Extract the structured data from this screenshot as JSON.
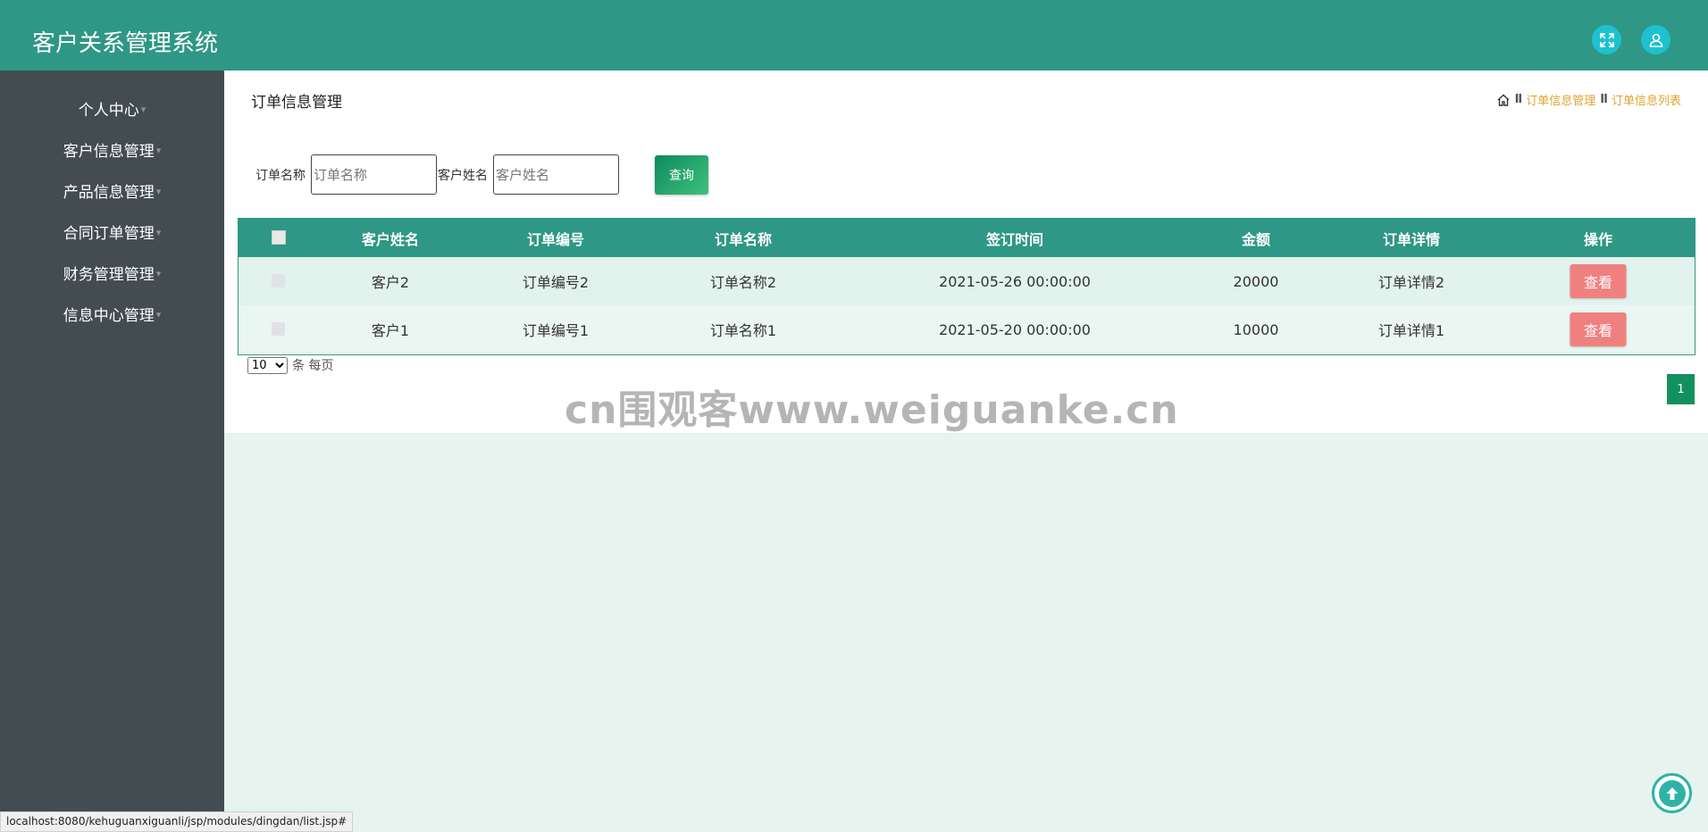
{
  "header": {
    "title": "客户关系管理系统",
    "fullscreen_icon": "expand-icon",
    "user_icon": "user-icon"
  },
  "sidebar": {
    "items": [
      {
        "label": "个人中心"
      },
      {
        "label": "客户信息管理"
      },
      {
        "label": "产品信息管理"
      },
      {
        "label": "合同订单管理"
      },
      {
        "label": "财务管理管理"
      },
      {
        "label": "信息中心管理"
      }
    ],
    "caret": "▾"
  },
  "main": {
    "title": "订单信息管理",
    "breadcrumb": {
      "sep": "II",
      "items": [
        "订单信息管理",
        "订单信息列表"
      ]
    }
  },
  "search": {
    "order_name_label": "订单名称",
    "order_name_placeholder": "订单名称",
    "customer_name_label": "客户姓名",
    "customer_name_placeholder": "客户姓名",
    "query_label": "查询"
  },
  "table": {
    "headers": [
      "客户姓名",
      "订单编号",
      "订单名称",
      "签订时间",
      "金额",
      "订单详情",
      "操作"
    ],
    "rows": [
      {
        "customer": "客户2",
        "order_no": "订单编号2",
        "order_name": "订单名称2",
        "signed_at": "2021-05-26 00:00:00",
        "amount": "20000",
        "details": "订单详情2",
        "action": "查看"
      },
      {
        "customer": "客户1",
        "order_no": "订单编号1",
        "order_name": "订单名称1",
        "signed_at": "2021-05-20 00:00:00",
        "amount": "10000",
        "details": "订单详情1",
        "action": "查看"
      }
    ]
  },
  "pagination": {
    "page_size": "10",
    "page_size_suffix": "条 每页",
    "current_page": "1"
  },
  "watermark": "cn围观客www.weiguanke.cn",
  "status_url": "localhost:8080/kehuguanxiguanli/jsp/modules/dingdan/list.jsp#",
  "colors": {
    "header": "#2f9785",
    "sidebar": "#434c51",
    "accent_button": "#f08080",
    "breadcrumb": "#e1a32f"
  }
}
